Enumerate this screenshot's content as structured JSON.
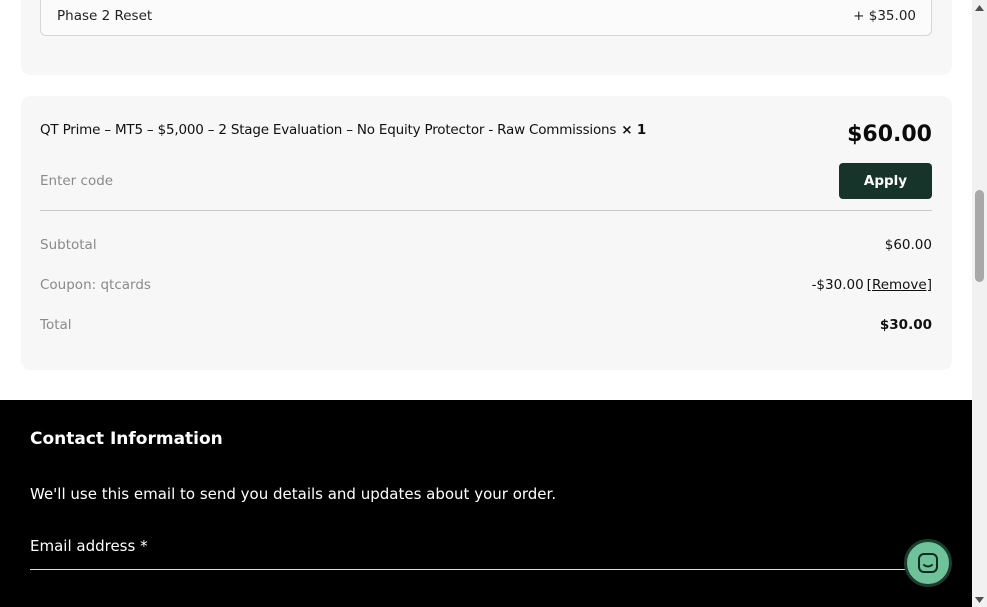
{
  "addon": {
    "name": "Phase 2 Reset",
    "price": "+ $35.00"
  },
  "order": {
    "product_name": "QT Prime – MT5 – $5,000 – 2 Stage Evaluation – No Equity Protector - Raw Commissions",
    "quantity": "× 1",
    "price": "$60.00",
    "coupon_placeholder": "Enter code",
    "apply_label": "Apply",
    "subtotal_label": "Subtotal",
    "subtotal_value": "$60.00",
    "coupon_label": "Coupon: qtcards",
    "coupon_value": "-$30.00",
    "remove_label": "[Remove]",
    "total_label": "Total",
    "total_value": "$30.00"
  },
  "contact": {
    "title": "Contact Information",
    "description": "We'll use this email to send you details and updates about your order.",
    "email_label": "Email address *"
  },
  "colors": {
    "apply_button": "#17342a",
    "chat_button": "#6fc39a",
    "contact_bg": "#000000",
    "card_bg": "#f7f7f7"
  },
  "icons": {
    "chat": "chat-bubble-icon",
    "scroll_up": "scroll-up-arrow-icon",
    "scroll_down": "scroll-down-arrow-icon"
  }
}
